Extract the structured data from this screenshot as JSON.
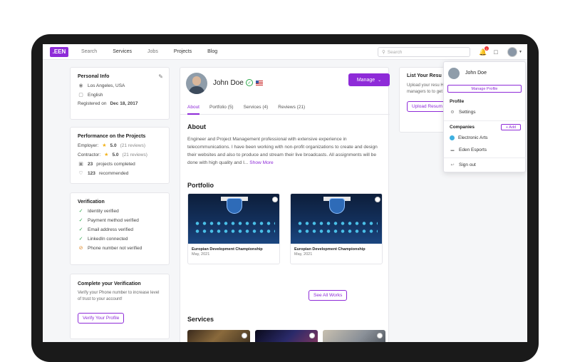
{
  "nav": {
    "logo": ".EEN",
    "links": [
      "Search",
      "Services",
      "Jobs",
      "Projects",
      "Blog"
    ],
    "search_placeholder": "Search",
    "notification_count": "1"
  },
  "personal": {
    "title": "Personal Info",
    "location": "Los Angeles, USA",
    "language": "English",
    "registered_prefix": "Registered on",
    "registered_date": "Dec 18, 2017"
  },
  "performance": {
    "title": "Performance on the Projects",
    "employer_label": "Employer:",
    "employer_rating": "5.0",
    "employer_reviews": "(21 reviews)",
    "contractor_label": "Contractor:",
    "contractor_rating": "5.0",
    "contractor_reviews": "(21 reviews)",
    "projects_count": "23",
    "projects_label": "projects completed",
    "recommended_count": "123",
    "recommended_label": "recommended"
  },
  "verification": {
    "title": "Verification",
    "items": [
      {
        "label": "Identity verified",
        "status": "ok"
      },
      {
        "label": "Payment method verified",
        "status": "ok"
      },
      {
        "label": "Email address verified",
        "status": "ok"
      },
      {
        "label": "LinkedIn connected",
        "status": "ok"
      },
      {
        "label": "Phone number not verified",
        "status": "warn"
      }
    ]
  },
  "complete": {
    "title": "Complete your Verification",
    "text": "Verify your Phone number to increase level of trust to your account!",
    "button": "Verify Your Profile"
  },
  "profile": {
    "name": "John Doe",
    "manage_button": "Manage",
    "tabs": [
      "About",
      "Portfolio (5)",
      "Services (4)",
      "Reviews (21)"
    ],
    "active_tab": 0
  },
  "about": {
    "title": "About",
    "text": "Engineer and Project Management professional with extensive experience in telecommunications. I have been working with non-profit organizations to create and design their websites and also to produce and stream their live broadcasts. All assignments will be done with high quality and I...",
    "more": "Show More"
  },
  "portfolio": {
    "title": "Portfolio",
    "items": [
      {
        "title": "Europian Development Championship",
        "date": "May, 2021"
      },
      {
        "title": "Europian Development Championship",
        "date": "May, 2021"
      }
    ],
    "see_all": "See All Works"
  },
  "services": {
    "title": "Services"
  },
  "resume": {
    "title": "List Your Resu",
    "text": "Upload your resu HR managers to to get hired!",
    "button": "Upload Resum"
  },
  "dropdown": {
    "name": "John Doe",
    "manage_profile": "Manage Profile",
    "profile_head": "Profile",
    "settings": "Settings",
    "companies_head": "Companies",
    "add": "+ Add",
    "companies": [
      "Electronic Arts",
      "Eden Esports"
    ],
    "sign_out": "Sign out"
  },
  "colors": {
    "accent": "#8e2bd8",
    "ok": "#2aa84a",
    "warn": "#e08a2a"
  }
}
